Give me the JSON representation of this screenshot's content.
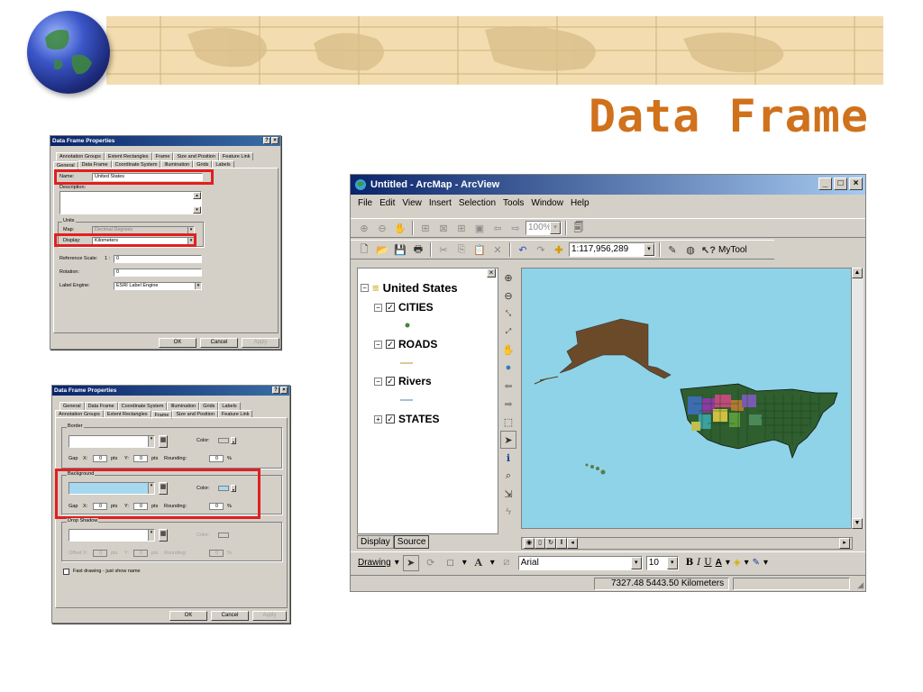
{
  "slide": {
    "title": "Data Frame"
  },
  "dialog_general": {
    "title": "Data Frame Properties",
    "tabs_back": [
      "Annotation Groups",
      "Extent Rectangles",
      "Frame",
      "Size and Position",
      "Feature Link"
    ],
    "tabs_front": [
      "General",
      "Data Frame",
      "Coordinate System",
      "Illumination",
      "Grids",
      "Labels"
    ],
    "active_tab": "General",
    "name_label": "Name:",
    "name_value": "United States",
    "description_label": "Description:",
    "units_label": "Units",
    "map_label": "Map:",
    "map_value": "Decimal Degrees",
    "display_label": "Display:",
    "display_value": "Kilometers",
    "reference_scale_label": "Reference Scale:",
    "reference_scale_prefix": "1 :",
    "reference_scale_value": "0",
    "rotation_label": "Rotation:",
    "rotation_value": "0",
    "label_engine_label": "Label Engine:",
    "label_engine_value": "ESRI Label Engine",
    "ok": "OK",
    "cancel": "Cancel",
    "apply": "Apply"
  },
  "dialog_frame": {
    "title": "Data Frame Properties",
    "tabs_back": [
      "General",
      "Data Frame",
      "Coordinate System",
      "Illumination",
      "Grids",
      "Labels"
    ],
    "tabs_front": [
      "Annotation Groups",
      "Extent Rectangles",
      "Frame",
      "Size and Position",
      "Feature Link"
    ],
    "active_tab": "Frame",
    "border_label": "Border",
    "background_label": "Background",
    "drop_shadow_label": "Drop Shadow",
    "color_label": "Color:",
    "gap_label": "Gap",
    "x_label": "X:",
    "y_label": "Y:",
    "pts": "pts",
    "rounding_label": "Rounding:",
    "percent": "%",
    "gap_x": "0",
    "gap_y": "0",
    "rounding": "0",
    "offset_label": "Offset",
    "fast_drawing_label": "Fast drawing - just show name",
    "ok": "OK",
    "cancel": "Cancel",
    "apply": "Apply",
    "border_color": "#000000",
    "background_color": "#a6d8f0"
  },
  "arcmap": {
    "title": "Untitled - ArcMap - ArcView",
    "menu": [
      "File",
      "Edit",
      "View",
      "Insert",
      "Selection",
      "Tools",
      "Window",
      "Help"
    ],
    "zoom_percent": "100%",
    "scale": "1:117,956,289",
    "mytool": "MyTool",
    "toc": {
      "frame_name": "United States",
      "layers": [
        {
          "name": "CITIES",
          "checked": true,
          "expanded": true
        },
        {
          "name": "ROADS",
          "checked": true,
          "expanded": true
        },
        {
          "name": "Rivers",
          "checked": true,
          "expanded": true
        },
        {
          "name": "STATES",
          "checked": true,
          "expanded": false
        }
      ],
      "tabs": [
        "Display",
        "Source"
      ]
    },
    "drawing_label": "Drawing",
    "font_name": "Arial",
    "font_size": "10",
    "bold": "B",
    "italic": "I",
    "underline": "U",
    "status": "7327.48  5443.50 Kilometers",
    "map_background": "#8fd3e8"
  }
}
